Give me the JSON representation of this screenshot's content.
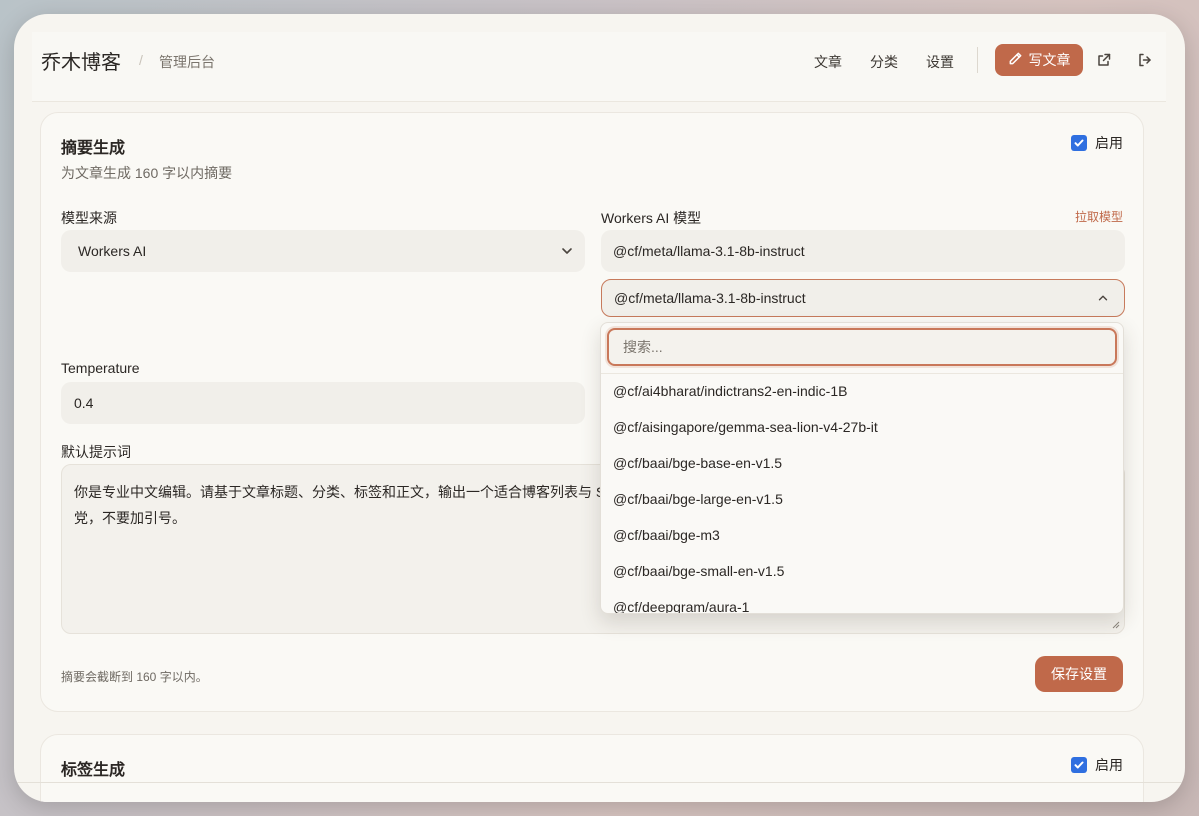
{
  "header": {
    "logo": "乔木博客",
    "separator": "/",
    "breadcrumb": "管理后台",
    "nav": [
      "文章",
      "分类",
      "设置"
    ],
    "write_label": "写文章"
  },
  "summary_card": {
    "title": "摘要生成",
    "subtitle": "为文章生成 160 字以内摘要",
    "enable_label": "启用",
    "enabled": true,
    "model_source_label": "模型来源",
    "model_source_value": "Workers AI",
    "workers_model_label": "Workers AI 模型",
    "fetch_models_label": "拉取模型",
    "model_input_value": "@cf/meta/llama-3.1-8b-instruct",
    "model_select_value": "@cf/meta/llama-3.1-8b-instruct",
    "temperature_label": "Temperature",
    "temperature_value": "0.4",
    "prompt_label": "默认提示词",
    "prompt_line1": "你是专业中文编辑。请基于文章标题、分类、标签和正文，输出一个适合博客列表与 S",
    "prompt_line2": "党，不要加引号。",
    "hint": "摘要会截断到 160 字以内。",
    "save_label": "保存设置"
  },
  "model_dropdown": {
    "search_placeholder": "搜索...",
    "options": [
      "@cf/ai4bharat/indictrans2-en-indic-1B",
      "@cf/aisingapore/gemma-sea-lion-v4-27b-it",
      "@cf/baai/bge-base-en-v1.5",
      "@cf/baai/bge-large-en-v1.5",
      "@cf/baai/bge-m3",
      "@cf/baai/bge-small-en-v1.5",
      "@cf/deepgram/aura-1"
    ]
  },
  "tags_card": {
    "title": "标签生成",
    "enable_label": "启用",
    "enabled": true
  },
  "colors": {
    "accent": "#c0694a",
    "checkbox": "#2f6fe0",
    "background": "#f7f5f0"
  }
}
